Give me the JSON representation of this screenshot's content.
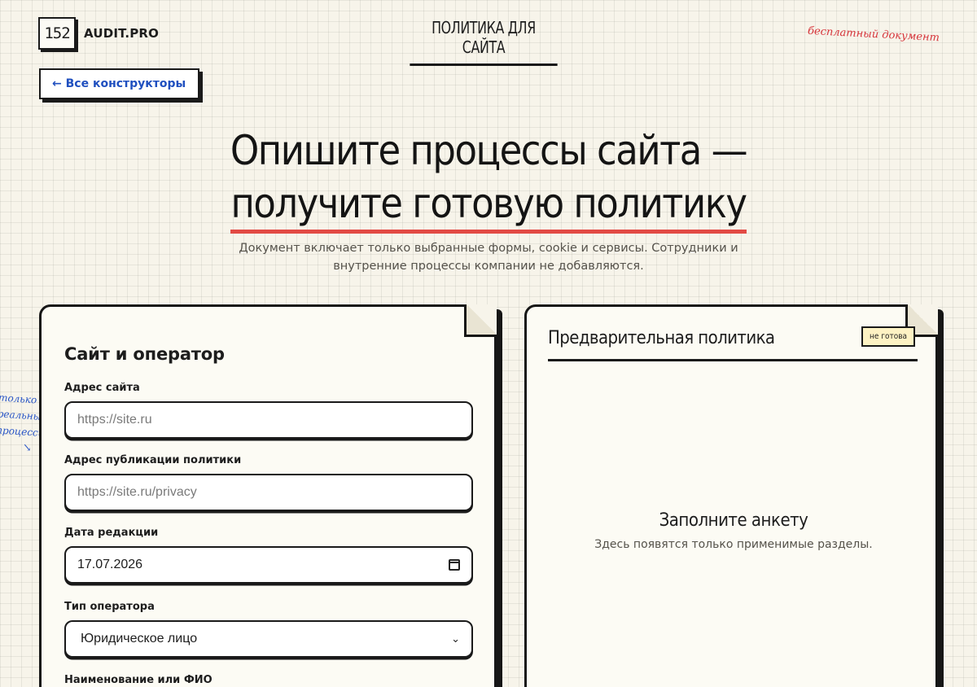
{
  "header": {
    "logo_number": "152",
    "logo_text": "AUDIT.PRO",
    "center_title": "ПОЛИТИКА ДЛЯ САЙТА",
    "free_note": "бесплатный документ",
    "back_label": "← Все конструкторы"
  },
  "hero": {
    "line1": "Опишите процессы сайта —",
    "line2": "получите готовую политику",
    "subtitle": "Документ включает только выбранные формы, cookie и сервисы. Сотрудники и внутренние процессы компании не добавляются.",
    "accent_color": "#e24a44"
  },
  "margin_note": {
    "lines": [
      "только",
      "реальные",
      "процессы"
    ],
    "arrow": "↘"
  },
  "form": {
    "section_title": "Сайт и оператор",
    "fields": [
      {
        "label": "Адрес сайта",
        "placeholder": "https://site.ru",
        "value": ""
      },
      {
        "label": "Адрес публикации политики",
        "placeholder": "https://site.ru/privacy",
        "value": ""
      },
      {
        "label": "Дата редакции",
        "value": "17.07.2026",
        "icon": "calendar-icon"
      },
      {
        "label": "Тип оператора",
        "value": "Юридическое лицо",
        "icon": "chevron-down-icon"
      },
      {
        "label": "Наименование или ФИО"
      }
    ]
  },
  "preview": {
    "title": "Предварительная политика",
    "status": "не готова",
    "empty_title": "Заполните анкету",
    "empty_subtitle": "Здесь появятся только применимые разделы."
  }
}
